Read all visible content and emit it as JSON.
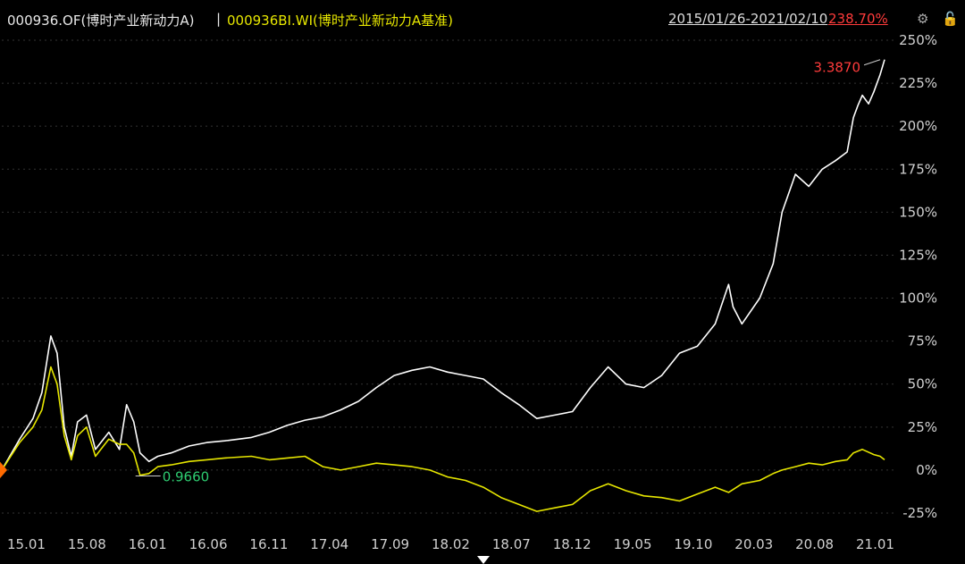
{
  "header": {
    "fund": "000936.OF(博时产业新动力A)",
    "separator": "|",
    "benchmark": "000936BI.WI(博时产业新动力A基准)",
    "range": "2015/01/26-2021/02/10",
    "percent": "238.70%",
    "icons": [
      "gear-icon",
      "lock-icon"
    ]
  },
  "colors": {
    "background": "#000000",
    "fund": "#ffffff",
    "benchmark": "#e6e600",
    "high_label": "#ff3b3b",
    "low_label": "#2ecc71",
    "grid": "#333333",
    "axis_text": "#d0d0d0"
  },
  "chart_data": {
    "type": "line",
    "x_ticks": [
      "15.01",
      "15.08",
      "16.01",
      "16.06",
      "16.11",
      "17.04",
      "17.09",
      "18.02",
      "18.07",
      "18.12",
      "19.05",
      "19.10",
      "20.03",
      "20.08",
      "21.01"
    ],
    "y_ticks": [
      "250%",
      "225%",
      "200%",
      "175%",
      "150%",
      "125%",
      "100%",
      "75%",
      "50%",
      "25%",
      "0%",
      "-25%"
    ],
    "ylim": [
      -25,
      250
    ],
    "annotations": [
      {
        "label": "3.3870",
        "t": 0.987,
        "y": 238.7,
        "kind": "high"
      },
      {
        "label": "0.9660",
        "t": 0.15,
        "y": -3.4,
        "kind": "low"
      }
    ],
    "series": [
      {
        "key": "fund",
        "points": [
          [
            0,
            0
          ],
          [
            0.02,
            18
          ],
          [
            0.035,
            30
          ],
          [
            0.045,
            45
          ],
          [
            0.055,
            78
          ],
          [
            0.062,
            68
          ],
          [
            0.07,
            25
          ],
          [
            0.078,
            8
          ],
          [
            0.085,
            28
          ],
          [
            0.095,
            32
          ],
          [
            0.105,
            12
          ],
          [
            0.12,
            22
          ],
          [
            0.132,
            12
          ],
          [
            0.14,
            38
          ],
          [
            0.148,
            28
          ],
          [
            0.155,
            10
          ],
          [
            0.165,
            5
          ],
          [
            0.175,
            8
          ],
          [
            0.19,
            10
          ],
          [
            0.21,
            14
          ],
          [
            0.23,
            16
          ],
          [
            0.25,
            17
          ],
          [
            0.28,
            19
          ],
          [
            0.3,
            22
          ],
          [
            0.32,
            26
          ],
          [
            0.34,
            29
          ],
          [
            0.36,
            31
          ],
          [
            0.38,
            35
          ],
          [
            0.4,
            40
          ],
          [
            0.42,
            48
          ],
          [
            0.44,
            55
          ],
          [
            0.46,
            58
          ],
          [
            0.48,
            60
          ],
          [
            0.5,
            57
          ],
          [
            0.52,
            55
          ],
          [
            0.54,
            53
          ],
          [
            0.56,
            45
          ],
          [
            0.58,
            38
          ],
          [
            0.6,
            30
          ],
          [
            0.62,
            32
          ],
          [
            0.64,
            34
          ],
          [
            0.66,
            48
          ],
          [
            0.68,
            60
          ],
          [
            0.7,
            50
          ],
          [
            0.72,
            48
          ],
          [
            0.74,
            55
          ],
          [
            0.76,
            68
          ],
          [
            0.78,
            72
          ],
          [
            0.8,
            85
          ],
          [
            0.815,
            108
          ],
          [
            0.82,
            95
          ],
          [
            0.83,
            85
          ],
          [
            0.85,
            100
          ],
          [
            0.865,
            120
          ],
          [
            0.875,
            150
          ],
          [
            0.89,
            172
          ],
          [
            0.905,
            165
          ],
          [
            0.92,
            175
          ],
          [
            0.935,
            180
          ],
          [
            0.948,
            185
          ],
          [
            0.955,
            205
          ],
          [
            0.96,
            212
          ],
          [
            0.965,
            218
          ],
          [
            0.972,
            213
          ],
          [
            0.978,
            220
          ],
          [
            0.985,
            230
          ],
          [
            0.99,
            238.7
          ]
        ]
      },
      {
        "key": "benchmark",
        "points": [
          [
            0,
            0
          ],
          [
            0.02,
            16
          ],
          [
            0.035,
            25
          ],
          [
            0.045,
            35
          ],
          [
            0.055,
            60
          ],
          [
            0.062,
            50
          ],
          [
            0.07,
            20
          ],
          [
            0.078,
            6
          ],
          [
            0.085,
            20
          ],
          [
            0.095,
            25
          ],
          [
            0.105,
            8
          ],
          [
            0.12,
            18
          ],
          [
            0.132,
            15
          ],
          [
            0.14,
            15
          ],
          [
            0.148,
            10
          ],
          [
            0.155,
            -3
          ],
          [
            0.165,
            -2
          ],
          [
            0.175,
            2
          ],
          [
            0.19,
            3
          ],
          [
            0.21,
            5
          ],
          [
            0.23,
            6
          ],
          [
            0.25,
            7
          ],
          [
            0.28,
            8
          ],
          [
            0.3,
            6
          ],
          [
            0.32,
            7
          ],
          [
            0.34,
            8
          ],
          [
            0.36,
            2
          ],
          [
            0.38,
            0
          ],
          [
            0.4,
            2
          ],
          [
            0.42,
            4
          ],
          [
            0.44,
            3
          ],
          [
            0.46,
            2
          ],
          [
            0.48,
            0
          ],
          [
            0.5,
            -4
          ],
          [
            0.52,
            -6
          ],
          [
            0.54,
            -10
          ],
          [
            0.56,
            -16
          ],
          [
            0.58,
            -20
          ],
          [
            0.6,
            -24
          ],
          [
            0.62,
            -22
          ],
          [
            0.64,
            -20
          ],
          [
            0.66,
            -12
          ],
          [
            0.68,
            -8
          ],
          [
            0.7,
            -12
          ],
          [
            0.72,
            -15
          ],
          [
            0.74,
            -16
          ],
          [
            0.76,
            -18
          ],
          [
            0.78,
            -14
          ],
          [
            0.8,
            -10
          ],
          [
            0.815,
            -13
          ],
          [
            0.83,
            -8
          ],
          [
            0.85,
            -6
          ],
          [
            0.865,
            -2
          ],
          [
            0.875,
            0
          ],
          [
            0.89,
            2
          ],
          [
            0.905,
            4
          ],
          [
            0.92,
            3
          ],
          [
            0.935,
            5
          ],
          [
            0.948,
            6
          ],
          [
            0.955,
            10
          ],
          [
            0.965,
            12
          ],
          [
            0.978,
            9
          ],
          [
            0.985,
            8
          ],
          [
            0.99,
            6
          ]
        ]
      }
    ]
  }
}
